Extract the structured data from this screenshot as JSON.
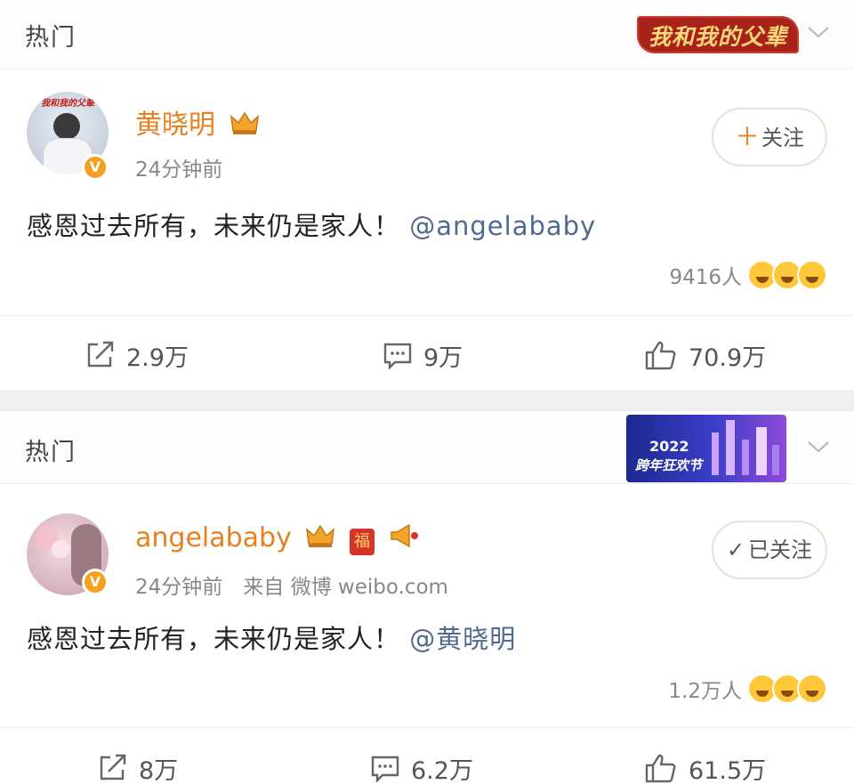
{
  "section1": {
    "title": "热门",
    "banner_text": "我和我的父辈"
  },
  "post1": {
    "author": "黄晓明",
    "meta": "24分钟前",
    "follow_label": "关注",
    "content_text": "感恩过去所有，未来仍是家人！",
    "mention": "@angelababy",
    "reaction_count": "9416人",
    "actions": {
      "repost": "2.9万",
      "comment": "9万",
      "like": "70.9万"
    },
    "avatar_caption": "我和我的父辈"
  },
  "section2": {
    "title": "热门",
    "banner_year": "2022",
    "banner_text": "跨年狂欢节"
  },
  "post2": {
    "author": "angelababy",
    "meta": "24分钟前　来自 微博 weibo.com",
    "follow_label": "已关注",
    "content_text": "感恩过去所有，未来仍是家人！",
    "mention": "@黄晓明",
    "reaction_count": "1.2万人",
    "actions": {
      "repost": "8万",
      "comment": "6.2万",
      "like": "61.5万"
    },
    "fu_badge": "福"
  },
  "colors": {
    "username": "#e8801d",
    "mention": "#4e6a91",
    "vip_badge": "#f7a020"
  }
}
